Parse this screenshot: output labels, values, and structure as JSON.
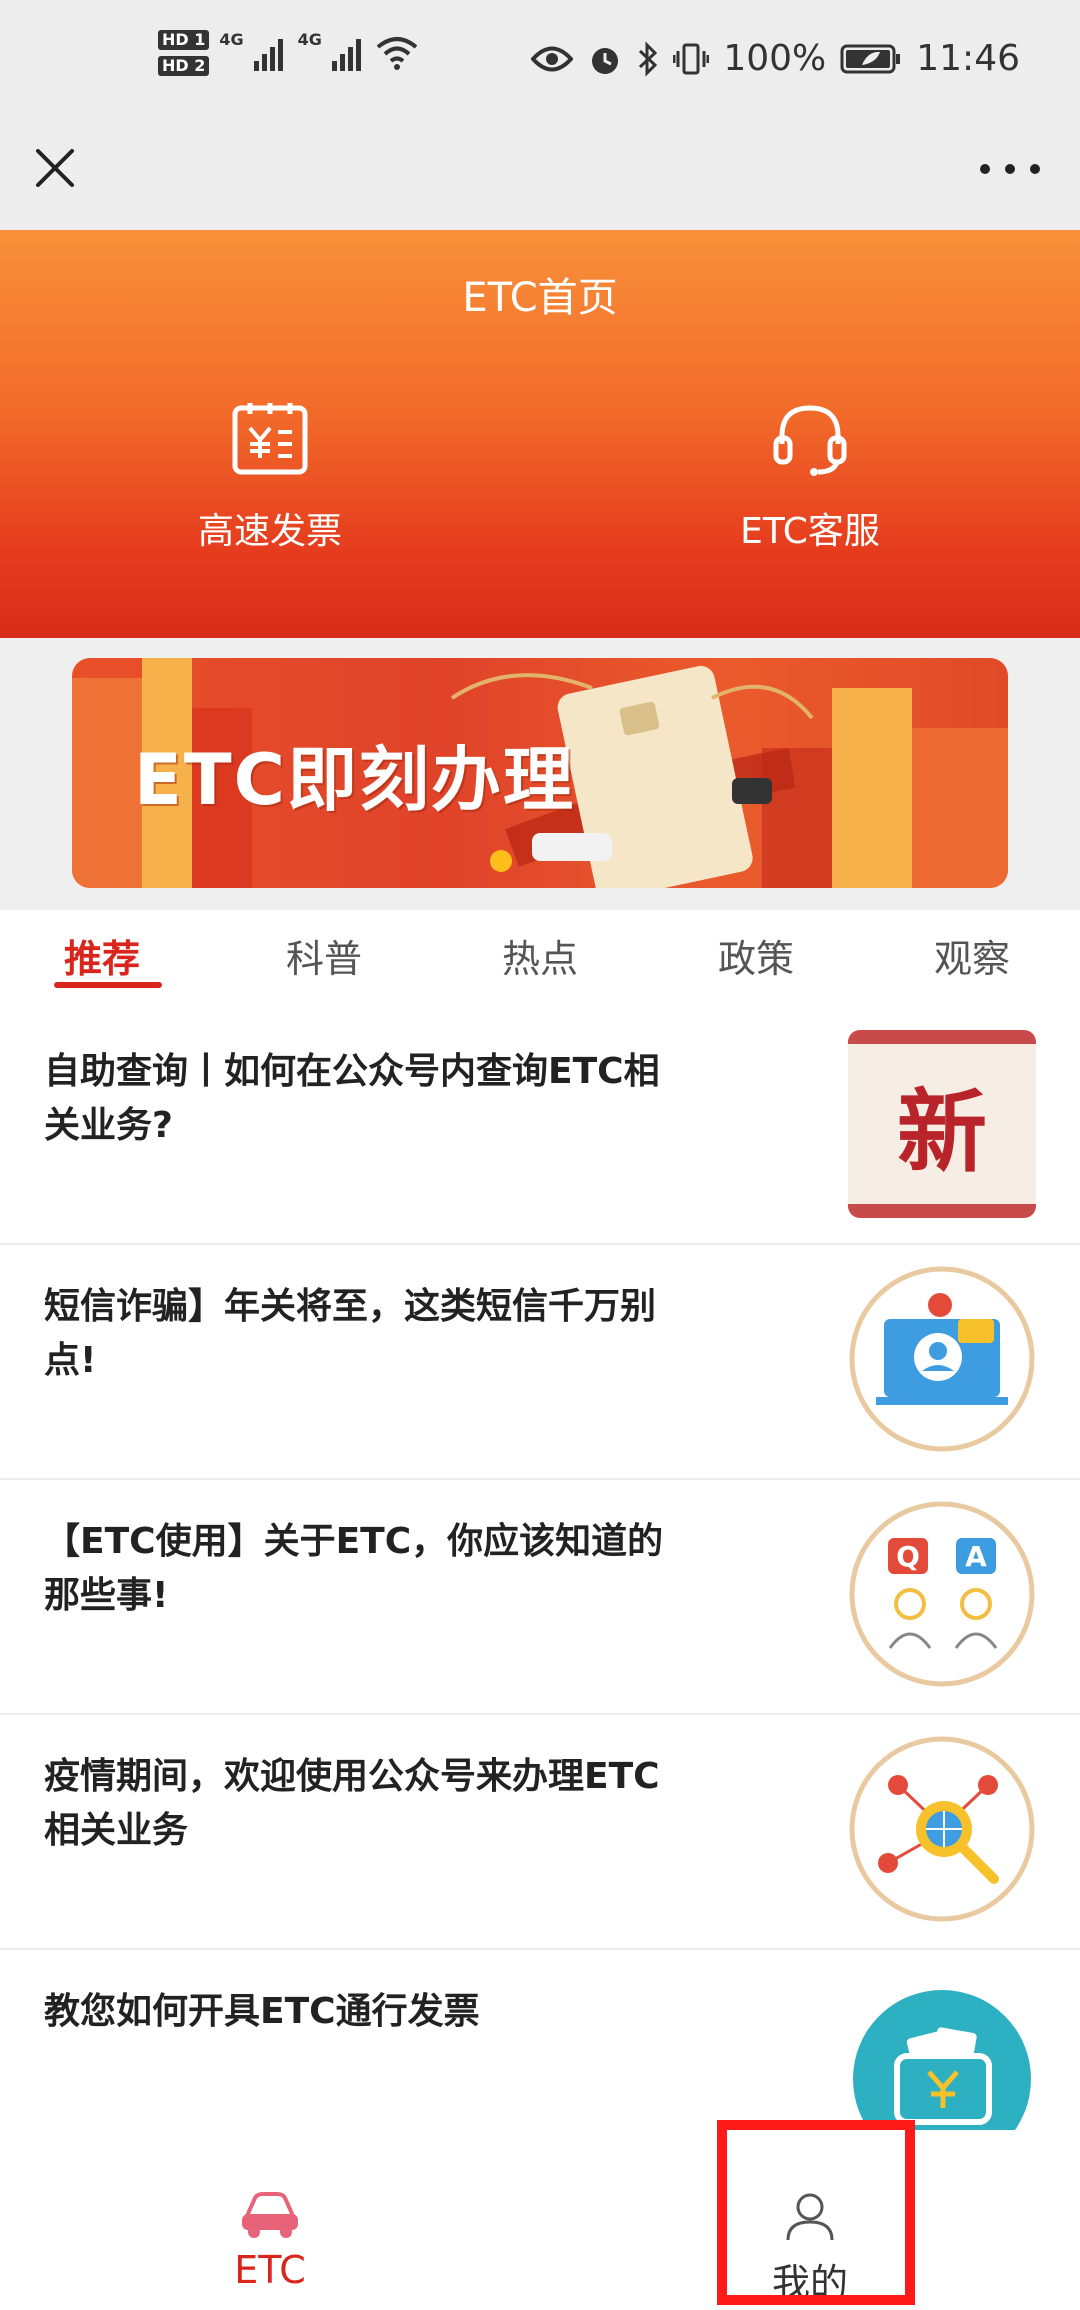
{
  "status_bar": {
    "hd1": "HD 1",
    "hd2": "HD 2",
    "net1": "4G",
    "net2": "4G",
    "battery": "100%",
    "time": "11:46"
  },
  "header": {
    "title": "ETC首页"
  },
  "quick_actions": {
    "invoice_label": "高速发票",
    "service_label": "ETC客服"
  },
  "banner": {
    "text": "ETC即刻办理"
  },
  "tabs": [
    {
      "label": "推荐"
    },
    {
      "label": "科普"
    },
    {
      "label": "热点"
    },
    {
      "label": "政策"
    },
    {
      "label": "观察"
    }
  ],
  "articles": [
    {
      "title": "自助查询丨如何在公众号内查询ETC相关业务?",
      "thumb_text": "新"
    },
    {
      "title": "短信诈骗】年关将至，这类短信千万别点!"
    },
    {
      "title": "【ETC使用】关于ETC，你应该知道的那些事!",
      "q_text": "Q",
      "a_text": "A"
    },
    {
      "title": "疫情期间，欢迎使用公众号来办理ETC相关业务"
    },
    {
      "title": "教您如何开具ETC通行发票"
    }
  ],
  "bottom_nav": {
    "etc_label": "ETC",
    "mine_label": "我的"
  },
  "colors": {
    "accent": "#d9251c",
    "hero_top": "#f8913a",
    "hero_bottom": "#d92c1a",
    "float": "#2cb0c2"
  }
}
